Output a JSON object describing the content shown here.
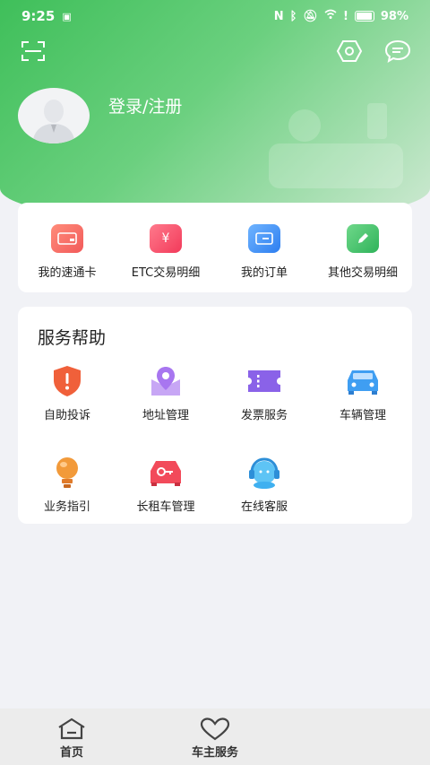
{
  "status_bar": {
    "time": "9:25",
    "battery": "98%"
  },
  "header": {
    "login_text": "登录/注册"
  },
  "quick_menu": [
    {
      "label": "我的速通卡",
      "icon": "card-icon",
      "color": "#f26a63"
    },
    {
      "label": "ETC交易明细",
      "icon": "yuan-icon",
      "color": "#f2546a"
    },
    {
      "label": "我的订单",
      "icon": "wallet-icon",
      "color": "#3d8cf0"
    },
    {
      "label": "其他交易明细",
      "icon": "edit-icon",
      "color": "#3fbe63"
    }
  ],
  "services": {
    "title": "服务帮助",
    "items": [
      {
        "label": "自助投诉",
        "icon": "complaint-shield-icon",
        "color": "#f0603a"
      },
      {
        "label": "地址管理",
        "icon": "location-icon",
        "color": "#a876f0"
      },
      {
        "label": "发票服务",
        "icon": "invoice-ticket-icon",
        "color": "#8a62e8"
      },
      {
        "label": "车辆管理",
        "icon": "car-icon",
        "color": "#3f9ef2"
      },
      {
        "label": "业务指引",
        "icon": "lightbulb-icon",
        "color": "#f29a3a"
      },
      {
        "label": "长租车管理",
        "icon": "car-key-icon",
        "color": "#f24a5a"
      },
      {
        "label": "在线客服",
        "icon": "headset-icon",
        "color": "#3fb0f0"
      }
    ]
  },
  "bottom_nav": [
    {
      "label": "首页",
      "icon": "home-icon"
    },
    {
      "label": "车主服务",
      "icon": "heart-icon"
    }
  ]
}
